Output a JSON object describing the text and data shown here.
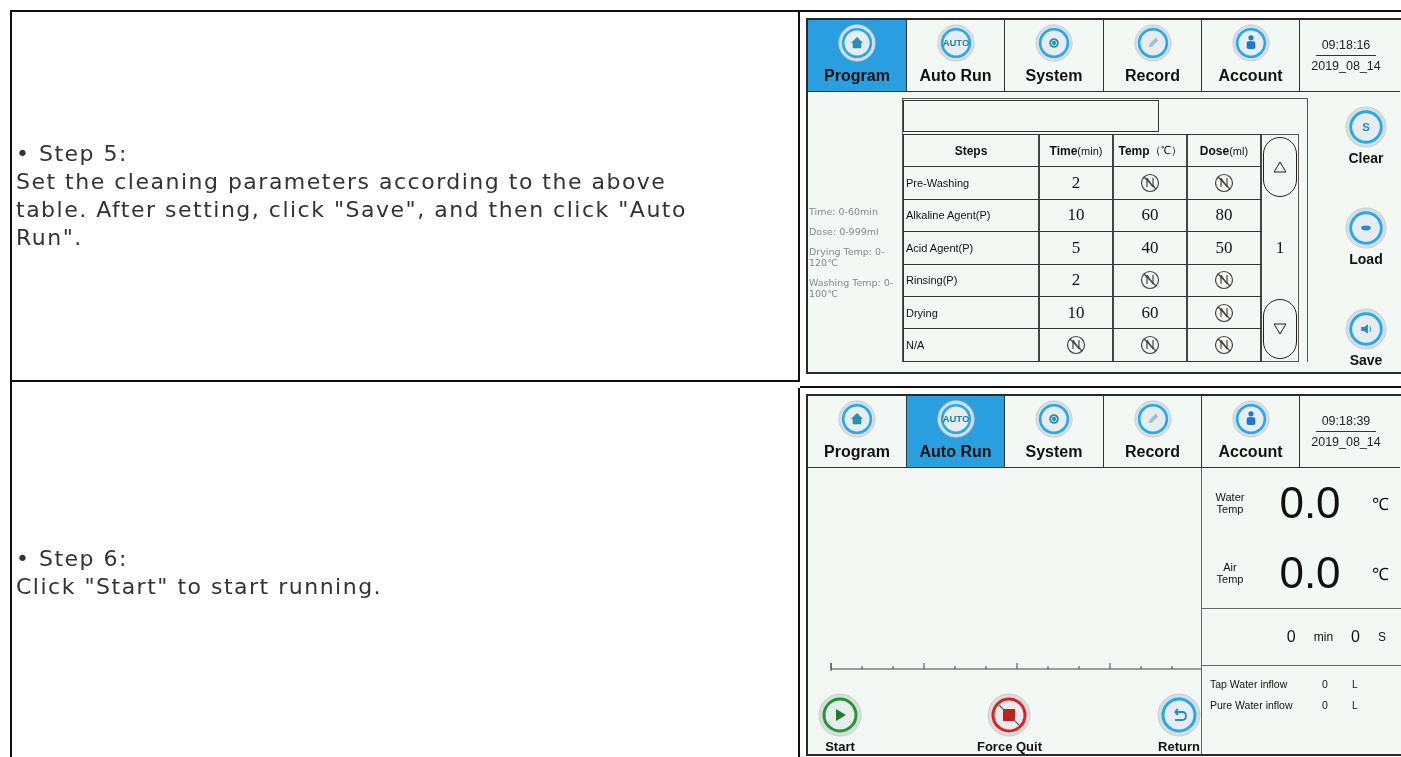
{
  "rows": [
    {
      "step": "• Step 5:",
      "text": "Set the cleaning parameters according to the above table. After setting, click \"Save\", and then click \"Auto Run\".",
      "screen": {
        "kind": "program",
        "nav": [
          {
            "label": "Program",
            "selected": true
          },
          {
            "label": "Auto Run",
            "icon_text": "AUTO",
            "selected": false
          },
          {
            "label": "System",
            "selected": false
          },
          {
            "label": "Record",
            "selected": false
          },
          {
            "label": "Account",
            "selected": false
          }
        ],
        "clock": {
          "time": "09:18:16",
          "date": "2019_08_14"
        },
        "ranges": [
          "Time: 0-60min",
          "Dose: 0-999ml",
          "Drying Temp: 0-120℃",
          "Washing Temp: 0-100℃"
        ],
        "columns": [
          {
            "label": "Steps"
          },
          {
            "label": "Time",
            "unit": "(min)"
          },
          {
            "label": "Temp",
            "unit": "（℃）"
          },
          {
            "label": "Dose",
            "unit": "(ml)"
          }
        ],
        "table_rows": [
          {
            "step": "Pre-Washing",
            "cells": [
              {
                "value": "2",
                "disabled": false
              },
              {
                "disabled": true
              },
              {
                "disabled": true
              }
            ]
          },
          {
            "step": "Alkaline Agent(P)",
            "cells": [
              {
                "value": "10",
                "disabled": false
              },
              {
                "value": "60",
                "disabled": false
              },
              {
                "value": "80",
                "disabled": false
              }
            ]
          },
          {
            "step": "Acid Agent(P)",
            "cells": [
              {
                "value": "5",
                "disabled": false
              },
              {
                "value": "40",
                "disabled": false
              },
              {
                "value": "50",
                "disabled": false
              }
            ]
          },
          {
            "step": "Rinsing(P)",
            "cells": [
              {
                "value": "2",
                "disabled": false
              },
              {
                "disabled": true
              },
              {
                "disabled": true
              }
            ]
          },
          {
            "step": "Drying",
            "cells": [
              {
                "value": "10",
                "disabled": false
              },
              {
                "value": "60",
                "disabled": false
              },
              {
                "disabled": true
              }
            ]
          },
          {
            "step": "N/A",
            "cells": [
              {
                "disabled": true
              },
              {
                "disabled": true
              },
              {
                "disabled": true
              }
            ]
          }
        ],
        "page": "1",
        "actions": [
          {
            "label": "Clear",
            "icon_text": "S"
          },
          {
            "label": "Load"
          },
          {
            "label": "Save"
          }
        ]
      }
    },
    {
      "step": "• Step 6:",
      "text": "Click \"Start\" to start running.",
      "screen": {
        "kind": "auto_run",
        "nav": [
          {
            "label": "Program",
            "selected": false
          },
          {
            "label": "Auto Run",
            "icon_text": "AUTO",
            "selected": true
          },
          {
            "label": "System",
            "selected": false
          },
          {
            "label": "Record",
            "selected": false
          },
          {
            "label": "Account",
            "selected": false
          }
        ],
        "clock": {
          "time": "09:18:39",
          "date": "2019_08_14"
        },
        "readings": [
          {
            "label": "Water Temp",
            "value": "0.0",
            "unit": "℃"
          },
          {
            "label": "Air Temp",
            "value": "0.0",
            "unit": "℃"
          }
        ],
        "timer": {
          "minutes": "0",
          "minutes_unit": "min",
          "seconds": "0",
          "seconds_unit": "S"
        },
        "flows": [
          {
            "label": "Tap Water inflow",
            "value": "0",
            "unit": "L"
          },
          {
            "label": "Pure Water inflow",
            "value": "0",
            "unit": "L"
          }
        ],
        "actions": [
          {
            "label": "Start"
          },
          {
            "label": "Force Quit"
          },
          {
            "label": "Return"
          }
        ]
      }
    }
  ]
}
